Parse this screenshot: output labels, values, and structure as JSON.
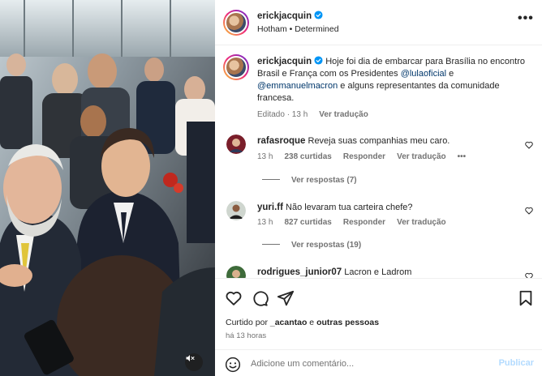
{
  "post": {
    "author": "erickjacquin",
    "audio": "Hotham • Determined"
  },
  "caption": {
    "author": "erickjacquin",
    "text_1": "Hoje foi dia de embarcar para Brasília no encontro Brasil e França com os Presidentes ",
    "mention_1": "@lulaoficial",
    "text_2": " e ",
    "mention_2": "@emmanuelmacron",
    "text_3": " e alguns representantes da comunidade francesa.",
    "edited": "Editado · 13 h",
    "translate": "Ver tradução"
  },
  "comments": [
    {
      "user": "rafasroque",
      "text": "Reveja suas companhias meu caro.",
      "time": "13 h",
      "likes": "238 curtidas",
      "reply": "Responder",
      "translate": "Ver tradução",
      "more": "•••",
      "view_replies": "Ver respostas (7)"
    },
    {
      "user": "yuri.ff",
      "text": "Não levaram tua carteira chefe?",
      "time": "13 h",
      "likes": "827 curtidas",
      "reply": "Responder",
      "translate": "Ver tradução",
      "view_replies": "Ver respostas (19)"
    },
    {
      "user": "rodrigues_junior07",
      "text": "Lacron e Ladrom"
    }
  ],
  "engagement": {
    "liked_by_prefix": "Curtido por ",
    "liked_by_user": "_acantao",
    "liked_by_suffix": " e ",
    "liked_by_others": "outras pessoas",
    "time_ago": "há 13 horas"
  },
  "comment_box": {
    "placeholder": "Adicione um comentário...",
    "post_label": "Publicar"
  },
  "icons": {
    "verified": "verified-badge-icon",
    "like": "heart-icon",
    "comment": "comment-icon",
    "share": "share-icon",
    "save": "bookmark-icon",
    "emoji": "emoji-icon",
    "mute": "muted-speaker-icon",
    "options": "more-options-icon"
  },
  "colors": {
    "verified": "#0095f6",
    "mention": "#00376b",
    "secondary_text": "#737373",
    "post_disabled": "#b3dbff"
  }
}
